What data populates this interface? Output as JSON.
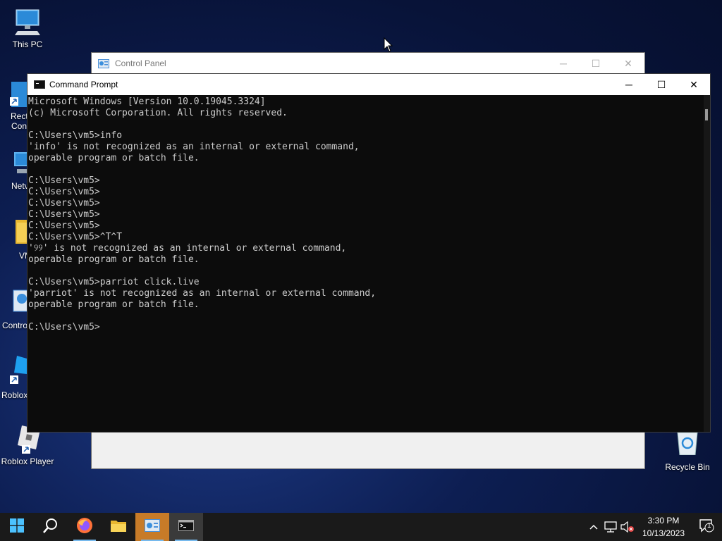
{
  "desktop": {
    "icons": [
      {
        "label": "This PC",
        "icon": "computer-icon"
      },
      {
        "label": "Roblox Player",
        "icon": "roblox-player-icon"
      },
      {
        "label": "Recycle Bin",
        "icon": "recycle-bin-icon"
      }
    ],
    "partial_labels": {
      "recycle": "Rect",
      "recycle2": "Con",
      "network": "Netv",
      "vm": "VM",
      "control": "Contro",
      "roblox": "Roblox"
    }
  },
  "control_panel": {
    "title": "Control Panel",
    "icon": "control-panel-icon"
  },
  "command_prompt": {
    "title": "Command Prompt",
    "icon": "cmd-icon",
    "lines": [
      "Microsoft Windows [Version 10.0.19045.3324]",
      "(c) Microsoft Corporation. All rights reserved.",
      "",
      "C:\\Users\\vm5>info",
      "'info' is not recognized as an internal or external command,",
      "operable program or batch file.",
      "",
      "C:\\Users\\vm5>",
      "C:\\Users\\vm5>",
      "C:\\Users\\vm5>",
      "C:\\Users\\vm5>",
      "C:\\Users\\vm5>",
      "C:\\Users\\vm5>^T^T",
      "'୨୨' is not recognized as an internal or external command,",
      "operable program or batch file.",
      "",
      "C:\\Users\\vm5>parriot click.live",
      "'parriot' is not recognized as an internal or external command,",
      "operable program or batch file.",
      "",
      "C:\\Users\\vm5>"
    ]
  },
  "window_controls": {
    "minimize": "─",
    "maximize": "☐",
    "close": "✕"
  },
  "taskbar": {
    "items": [
      {
        "name": "start-button",
        "icon": "windows-logo-icon"
      },
      {
        "name": "search-button",
        "icon": "search-icon"
      },
      {
        "name": "firefox-button",
        "icon": "firefox-icon"
      },
      {
        "name": "file-explorer-button",
        "icon": "folder-icon"
      },
      {
        "name": "control-panel-taskbar-button",
        "icon": "control-panel-icon"
      },
      {
        "name": "cmd-taskbar-button",
        "icon": "cmd-icon"
      }
    ],
    "tray": {
      "chevron": "^",
      "time": "3:30 PM",
      "date": "10/13/2023",
      "notification_count": "1"
    }
  },
  "colors": {
    "console_bg": "#0c0c0c",
    "console_text": "#cccccc",
    "taskbar_bg": "#1a1a1a",
    "cp_taskbar_accent": "#c77b28"
  }
}
